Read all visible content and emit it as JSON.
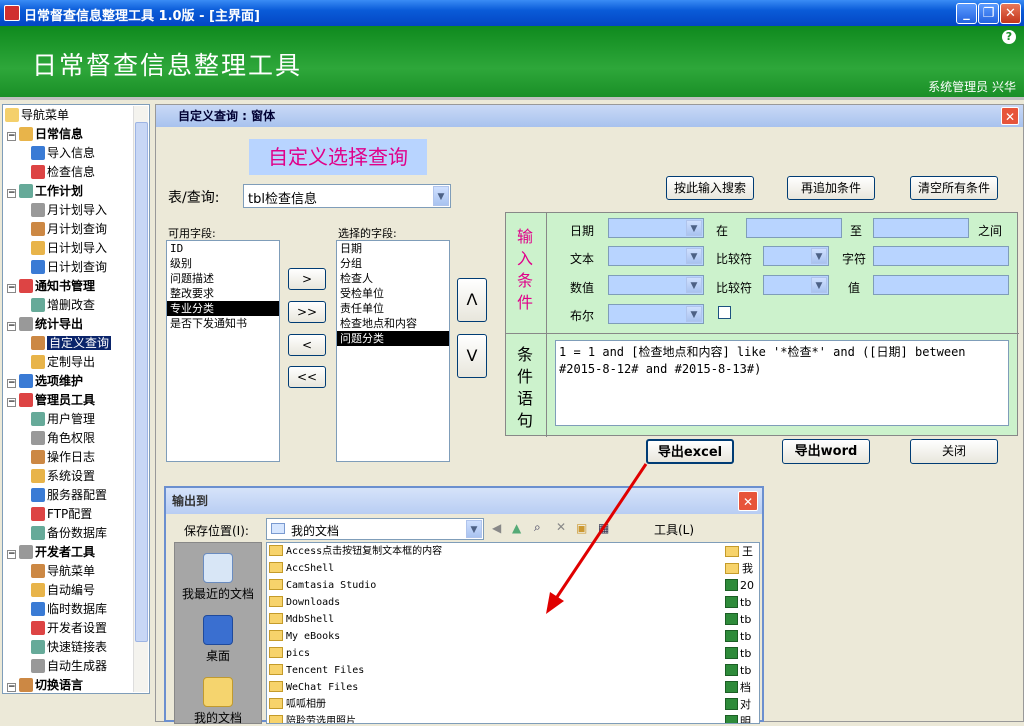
{
  "app": {
    "title": "日常督查信息整理工具 1.0版 - [主界面]",
    "banner_title": "日常督查信息整理工具",
    "user": "系统管理员 兴华",
    "help": "?"
  },
  "window_buttons": {
    "minimize": "_",
    "restore": "❐",
    "close": "✕"
  },
  "nav": {
    "root": "导航菜单",
    "items": [
      {
        "label": "日常信息",
        "cat": true
      },
      {
        "label": "导入信息"
      },
      {
        "label": "检查信息"
      },
      {
        "label": "工作计划",
        "cat": true
      },
      {
        "label": "月计划导入"
      },
      {
        "label": "月计划查询"
      },
      {
        "label": "日计划导入"
      },
      {
        "label": "日计划查询"
      },
      {
        "label": "通知书管理",
        "cat": true
      },
      {
        "label": "增删改查"
      },
      {
        "label": "统计导出",
        "cat": true
      },
      {
        "label": "自定义查询",
        "selected": true
      },
      {
        "label": "定制导出"
      },
      {
        "label": "选项维护",
        "cat": true
      },
      {
        "label": "管理员工具",
        "cat": true
      },
      {
        "label": "用户管理"
      },
      {
        "label": "角色权限"
      },
      {
        "label": "操作日志"
      },
      {
        "label": "系统设置"
      },
      {
        "label": "服务器配置"
      },
      {
        "label": "FTP配置"
      },
      {
        "label": "备份数据库"
      },
      {
        "label": "开发者工具",
        "cat": true
      },
      {
        "label": "导航菜单"
      },
      {
        "label": "自动编号"
      },
      {
        "label": "临时数据库"
      },
      {
        "label": "开发者设置"
      },
      {
        "label": "快速链接表"
      },
      {
        "label": "自动生成器"
      },
      {
        "label": "切换语言",
        "cat": true
      }
    ]
  },
  "query_window": {
    "title": "自定义查询 : 窗体",
    "heading": "自定义选择查询",
    "table_label": "表/查询:",
    "table_value": "tbl检查信息",
    "available_label": "可用字段:",
    "available_fields": [
      "ID",
      "级别",
      "问题描述",
      "整改要求",
      "专业分类",
      "是否下发通知书"
    ],
    "available_selected": "专业分类",
    "selected_label": "选择的字段:",
    "selected_fields": [
      "日期",
      "分组",
      "检查人",
      "受检单位",
      "责任单位",
      "检查地点和内容",
      "问题分类"
    ],
    "selected_selected": "问题分类",
    "move_buttons": [
      ">",
      ">>",
      "<",
      "<<"
    ],
    "order_buttons": [
      "Λ",
      "V"
    ],
    "top_buttons": {
      "search": "按此输入搜索",
      "add": "再追加条件",
      "clear": "清空所有条件"
    },
    "input_condition_label": "输入条件",
    "cond_rows": {
      "date": "日期",
      "in": "在",
      "to": "至",
      "between": "之间",
      "text": "文本",
      "compare": "比较符",
      "char": "字符",
      "number": "数值",
      "value": "值",
      "bool": "布尔"
    },
    "condition_label": "条件语句",
    "sql": "1 = 1 and [检查地点和内容] like '*检查*' and ([日期] between #2015-8-12# and #2015-8-13#)",
    "bottom_buttons": {
      "excel": "导出excel",
      "word": "导出word",
      "close": "关闭"
    }
  },
  "save_dialog": {
    "title": "输出到",
    "save_in_label": "保存位置(I):",
    "save_in_value": "我的文档",
    "toolbar_tools": "工具(L)",
    "places": [
      "我最近的文档",
      "桌面",
      "我的文档"
    ],
    "folders": [
      "Access点击按钮复制文本框的内容",
      "AccShell",
      "Camtasia Studio",
      "Downloads",
      "MdbShell",
      "My eBooks",
      "pics",
      "Tencent Files",
      "WeChat Files",
      "呱呱相册",
      "陪聆劳选用照片"
    ],
    "right_items": [
      "王",
      "我",
      "20",
      "tb",
      "tb",
      "tb",
      "tb",
      "tb",
      "档",
      "对",
      "明"
    ]
  },
  "colors": {
    "banner": "#1a8f27",
    "selection": "#0a246a",
    "cond_bg": "#ccf2cc",
    "heading_text": "#e0008a",
    "arrow": "#e00000"
  }
}
